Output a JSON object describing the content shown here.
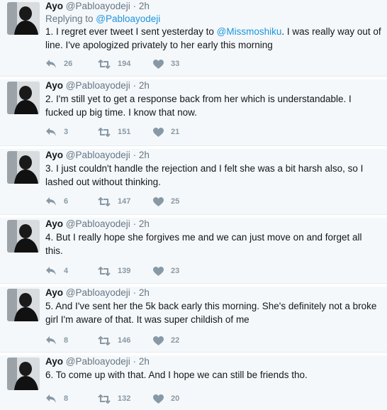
{
  "tweets": [
    {
      "name": "Ayo",
      "handle": "@Pabloayodeji",
      "separator": "·",
      "time": "2h",
      "replying_prefix": "Replying to ",
      "replying_handle": "@Pabloayodeji",
      "text_before": "1. I regret ever tweet I sent yesterday to ",
      "mention": "@Missmoshiku",
      "text_after": ". I was really way out of line. I've apologized privately to her early this morning",
      "replies": "26",
      "retweets": "194",
      "likes": "33"
    },
    {
      "name": "Ayo",
      "handle": "@Pabloayodeji",
      "separator": "·",
      "time": "2h",
      "text": "2. I'm still yet to get a response back from her which is understandable. I fucked up big time. I know that now.",
      "replies": "3",
      "retweets": "151",
      "likes": "21"
    },
    {
      "name": "Ayo",
      "handle": "@Pabloayodeji",
      "separator": "·",
      "time": "2h",
      "text": "3. I just couldn't handle the rejection and I felt she was a bit harsh also, so I lashed out without thinking.",
      "replies": "6",
      "retweets": "147",
      "likes": "25"
    },
    {
      "name": "Ayo",
      "handle": "@Pabloayodeji",
      "separator": "·",
      "time": "2h",
      "text": "4. But I really hope she forgives me and we can just move on and forget all this.",
      "replies": "4",
      "retweets": "139",
      "likes": "23"
    },
    {
      "name": "Ayo",
      "handle": "@Pabloayodeji",
      "separator": "·",
      "time": "2h",
      "text": "5. And I've sent her the 5k back early this morning. She's definitely not a broke girl I'm aware of that. It was super childish of me",
      "replies": "8",
      "retweets": "146",
      "likes": "22"
    },
    {
      "name": "Ayo",
      "handle": "@Pabloayodeji",
      "separator": "·",
      "time": "2h",
      "text": "6. To come up with that. And I hope we can still be friends tho.",
      "replies": "8",
      "retweets": "132",
      "likes": "20"
    }
  ],
  "colors": {
    "thread_line": "#4ab3f4",
    "link": "#1b95e0",
    "muted": "#657786",
    "icon": "#8899a6",
    "background": "#f5f8fa"
  },
  "icons": {
    "reply": "reply-icon",
    "retweet": "retweet-icon",
    "like": "heart-icon"
  }
}
